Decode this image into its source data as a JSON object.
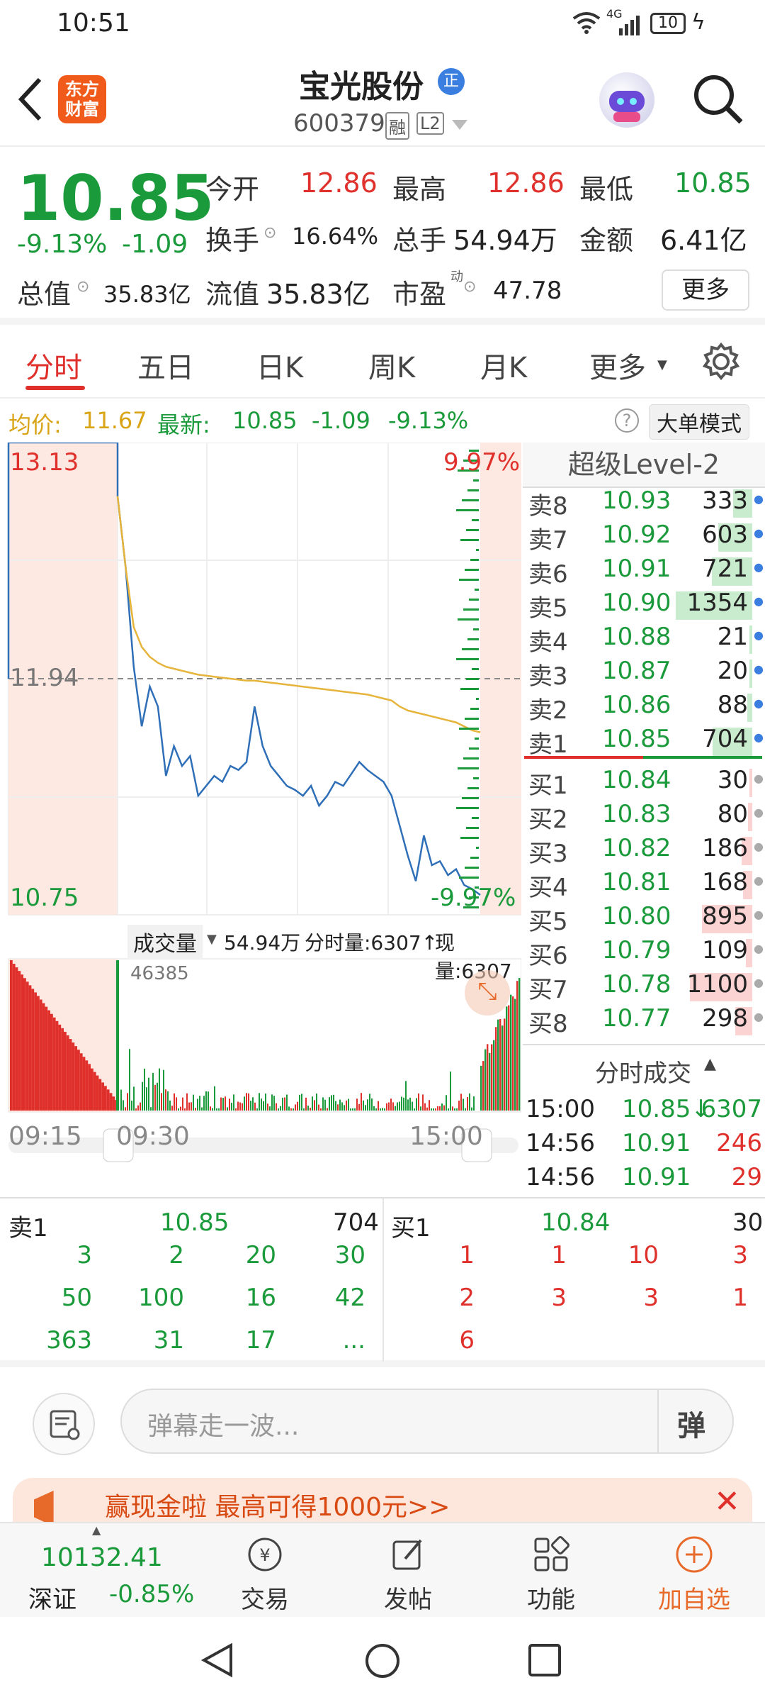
{
  "status": {
    "time": "10:51",
    "network": "4G",
    "battery": "10"
  },
  "header": {
    "logo_text": "东方财富",
    "stock_name": "宝光股份",
    "badge": "正",
    "code": "600379",
    "tag_margin": "融",
    "tag_level": "L2"
  },
  "quote": {
    "price": "10.85",
    "change_pct": "-9.13%",
    "change": "-1.09",
    "open_label": "今开",
    "open": "12.86",
    "high_label": "最高",
    "high": "12.86",
    "low_label": "最低",
    "low": "10.85",
    "turnover_label": "换手",
    "turnover": "16.64%",
    "volume_label": "总手",
    "volume": "54.94万",
    "amount_label": "金额",
    "amount": "6.41亿",
    "mktcap_label": "总值",
    "mktcap": "35.83亿",
    "float_label": "流值",
    "float": "35.83亿",
    "pe_label": "市盈",
    "pe_sup": "动",
    "pe": "47.78",
    "more": "更多"
  },
  "tabs": [
    "分时",
    "五日",
    "日K",
    "周K",
    "月K",
    "更多"
  ],
  "info": {
    "avg_label": "均价:",
    "avg": "11.67",
    "last_label": "最新:",
    "last": "10.85",
    "chg": "-1.09",
    "chg_pct": "-9.13%",
    "help": "?",
    "big_order": "大单模式"
  },
  "chart": {
    "ymax": "13.13",
    "ymid": "11.94",
    "ymin": "10.75",
    "pct_top": "9.97%",
    "pct_bottom": "-9.97%",
    "vol_label": "成交量",
    "vol_total": "54.94万",
    "vol_tick": "分时量:6307↑",
    "vol_now": "现量:6307",
    "vol_max": "46385",
    "time_labels": [
      "09:15",
      "09:30",
      "15:00"
    ]
  },
  "chart_data": {
    "type": "line",
    "ylim": [
      10.75,
      13.13
    ],
    "series": [
      {
        "name": "price",
        "values": [
          12.86,
          12.5,
          12.0,
          11.7,
          11.9,
          11.8,
          11.45,
          11.6,
          11.5,
          11.55,
          11.35,
          11.4,
          11.45,
          11.42,
          11.5,
          11.48,
          11.52,
          11.8,
          11.6,
          11.5,
          11.45,
          11.4,
          11.38,
          11.35,
          11.4,
          11.3,
          11.35,
          11.42,
          11.4,
          11.46,
          11.52,
          11.48,
          11.45,
          11.42,
          11.35,
          11.2,
          11.05,
          10.92,
          11.15,
          11.0,
          11.02,
          10.95,
          10.98,
          10.9,
          10.88,
          10.85
        ]
      },
      {
        "name": "avg",
        "values": [
          12.86,
          12.5,
          12.2,
          12.1,
          12.05,
          12.02,
          12.0,
          11.99,
          11.98,
          11.97,
          11.96,
          11.955,
          11.95,
          11.945,
          11.94,
          11.935,
          11.93,
          11.93,
          11.925,
          11.92,
          11.915,
          11.91,
          11.905,
          11.9,
          11.895,
          11.89,
          11.885,
          11.88,
          11.875,
          11.87,
          11.865,
          11.86,
          11.85,
          11.84,
          11.83,
          11.8,
          11.78,
          11.77,
          11.76,
          11.75,
          11.74,
          11.73,
          11.72,
          11.7,
          11.68,
          11.67
        ]
      }
    ]
  },
  "level2": {
    "title": "超级Level-2",
    "asks": [
      {
        "label": "卖8",
        "price": "10.93",
        "vol": "333"
      },
      {
        "label": "卖7",
        "price": "10.92",
        "vol": "603"
      },
      {
        "label": "卖6",
        "price": "10.91",
        "vol": "721"
      },
      {
        "label": "卖5",
        "price": "10.90",
        "vol": "1354"
      },
      {
        "label": "卖4",
        "price": "10.88",
        "vol": "21"
      },
      {
        "label": "卖3",
        "price": "10.87",
        "vol": "20"
      },
      {
        "label": "卖2",
        "price": "10.86",
        "vol": "88"
      },
      {
        "label": "卖1",
        "price": "10.85",
        "vol": "704"
      }
    ],
    "bids": [
      {
        "label": "买1",
        "price": "10.84",
        "vol": "30"
      },
      {
        "label": "买2",
        "price": "10.83",
        "vol": "80"
      },
      {
        "label": "买3",
        "price": "10.82",
        "vol": "186"
      },
      {
        "label": "买4",
        "price": "10.81",
        "vol": "168"
      },
      {
        "label": "买5",
        "price": "10.80",
        "vol": "895"
      },
      {
        "label": "买6",
        "price": "10.79",
        "vol": "109"
      },
      {
        "label": "买7",
        "price": "10.78",
        "vol": "1100"
      },
      {
        "label": "买8",
        "price": "10.77",
        "vol": "298"
      }
    ],
    "ticks_title": "分时成交",
    "ticks": [
      {
        "time": "15:00",
        "price": "10.85↓",
        "vol": "6307"
      },
      {
        "time": "14:56",
        "price": "10.91",
        "vol": "246"
      },
      {
        "time": "14:56",
        "price": "10.91",
        "vol": "29"
      }
    ]
  },
  "depth": {
    "sell_label": "卖1",
    "sell_price": "10.85",
    "sell_vol": "704",
    "buy_label": "买1",
    "buy_price": "10.84",
    "buy_vol": "30",
    "sell_queue": [
      "3",
      "2",
      "20",
      "30",
      "50",
      "100",
      "16",
      "42",
      "363",
      "31",
      "17",
      "..."
    ],
    "buy_queue": [
      "1",
      "1",
      "10",
      "3",
      "2",
      "3",
      "3",
      "1",
      "6"
    ]
  },
  "comment": {
    "placeholder": "弹幕走一波...",
    "danmu": "弹"
  },
  "banner": {
    "text": "赢现金啦   最高可得1000元>>"
  },
  "bottomnav": {
    "index_value": "10132.41",
    "index_name": "深证",
    "index_chg": "-0.85%",
    "items": [
      "交易",
      "发帖",
      "功能",
      "加自选"
    ]
  }
}
